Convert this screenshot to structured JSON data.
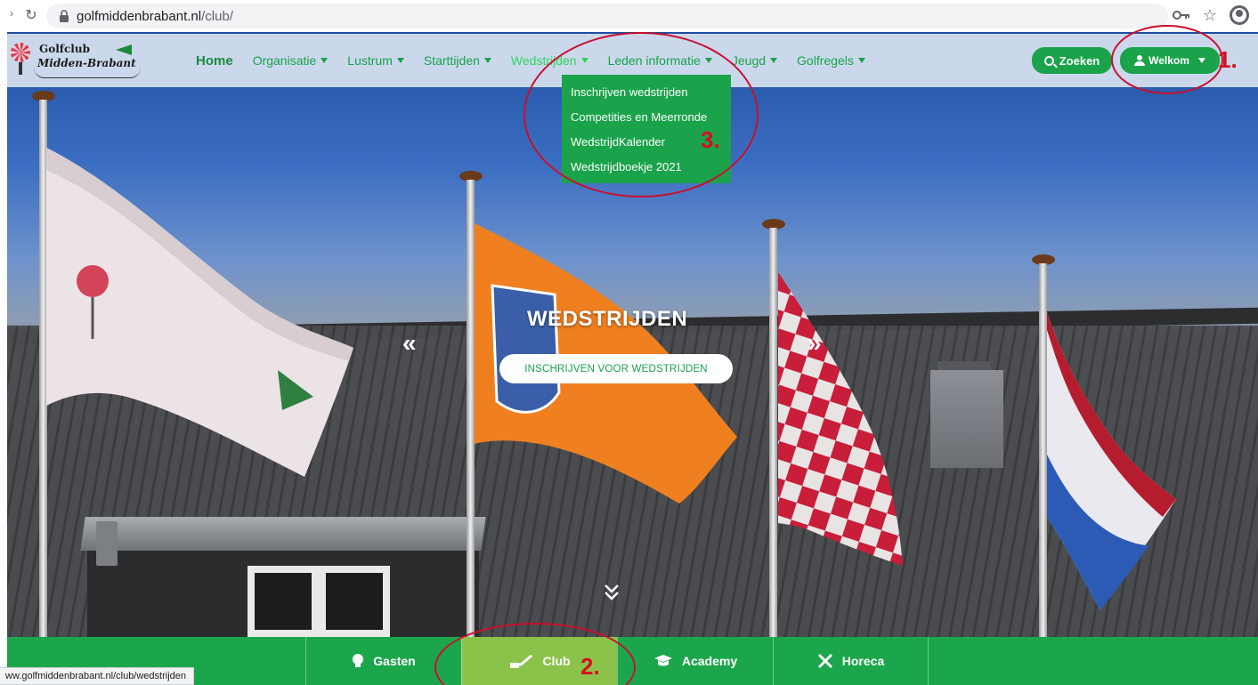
{
  "browser": {
    "reload_icon": "reload-icon",
    "url_domain": "golfmiddenbrabant.nl",
    "url_path": "/club/",
    "status_url": "ww.golfmiddenbrabant.nl/club/wedstrijden"
  },
  "logo": {
    "line1": "Golfclub",
    "line2": "Midden-Brabant"
  },
  "nav": {
    "items": [
      {
        "label": "Home"
      },
      {
        "label": "Organisatie"
      },
      {
        "label": "Lustrum"
      },
      {
        "label": "Starttijden"
      },
      {
        "label": "Wedstrijden"
      },
      {
        "label": "Leden informatie"
      },
      {
        "label": "Jeugd"
      },
      {
        "label": "Golfregels"
      }
    ],
    "search_label": "Zoeken",
    "welcome_label": "Welkom"
  },
  "dropdown": {
    "items": [
      {
        "label": "Inschrijven wedstrijden"
      },
      {
        "label": "Competities en Meerronde"
      },
      {
        "label": "WedstrijdKalender"
      },
      {
        "label": "Wedstrijdboekje 2021"
      }
    ]
  },
  "hero": {
    "title": "WEDSTRIJDEN",
    "cta": "INSCHRIJVEN VOOR WEDSTRIJDEN",
    "prev_arrow": "«",
    "next_arrow": "»"
  },
  "tabs": [
    {
      "label": "Gasten",
      "icon": "lightbulb-icon"
    },
    {
      "label": "Club",
      "icon": "golf-club-icon"
    },
    {
      "label": "Academy",
      "icon": "graduation-cap-icon"
    },
    {
      "label": "Horeca",
      "icon": "cutlery-icon"
    }
  ],
  "annotations": {
    "n1": "1.",
    "n2": "2.",
    "n3": "3."
  },
  "colors": {
    "brand_green": "#1aa34a",
    "active_tab": "#8bc34a",
    "annotation_red": "#c8102e"
  }
}
